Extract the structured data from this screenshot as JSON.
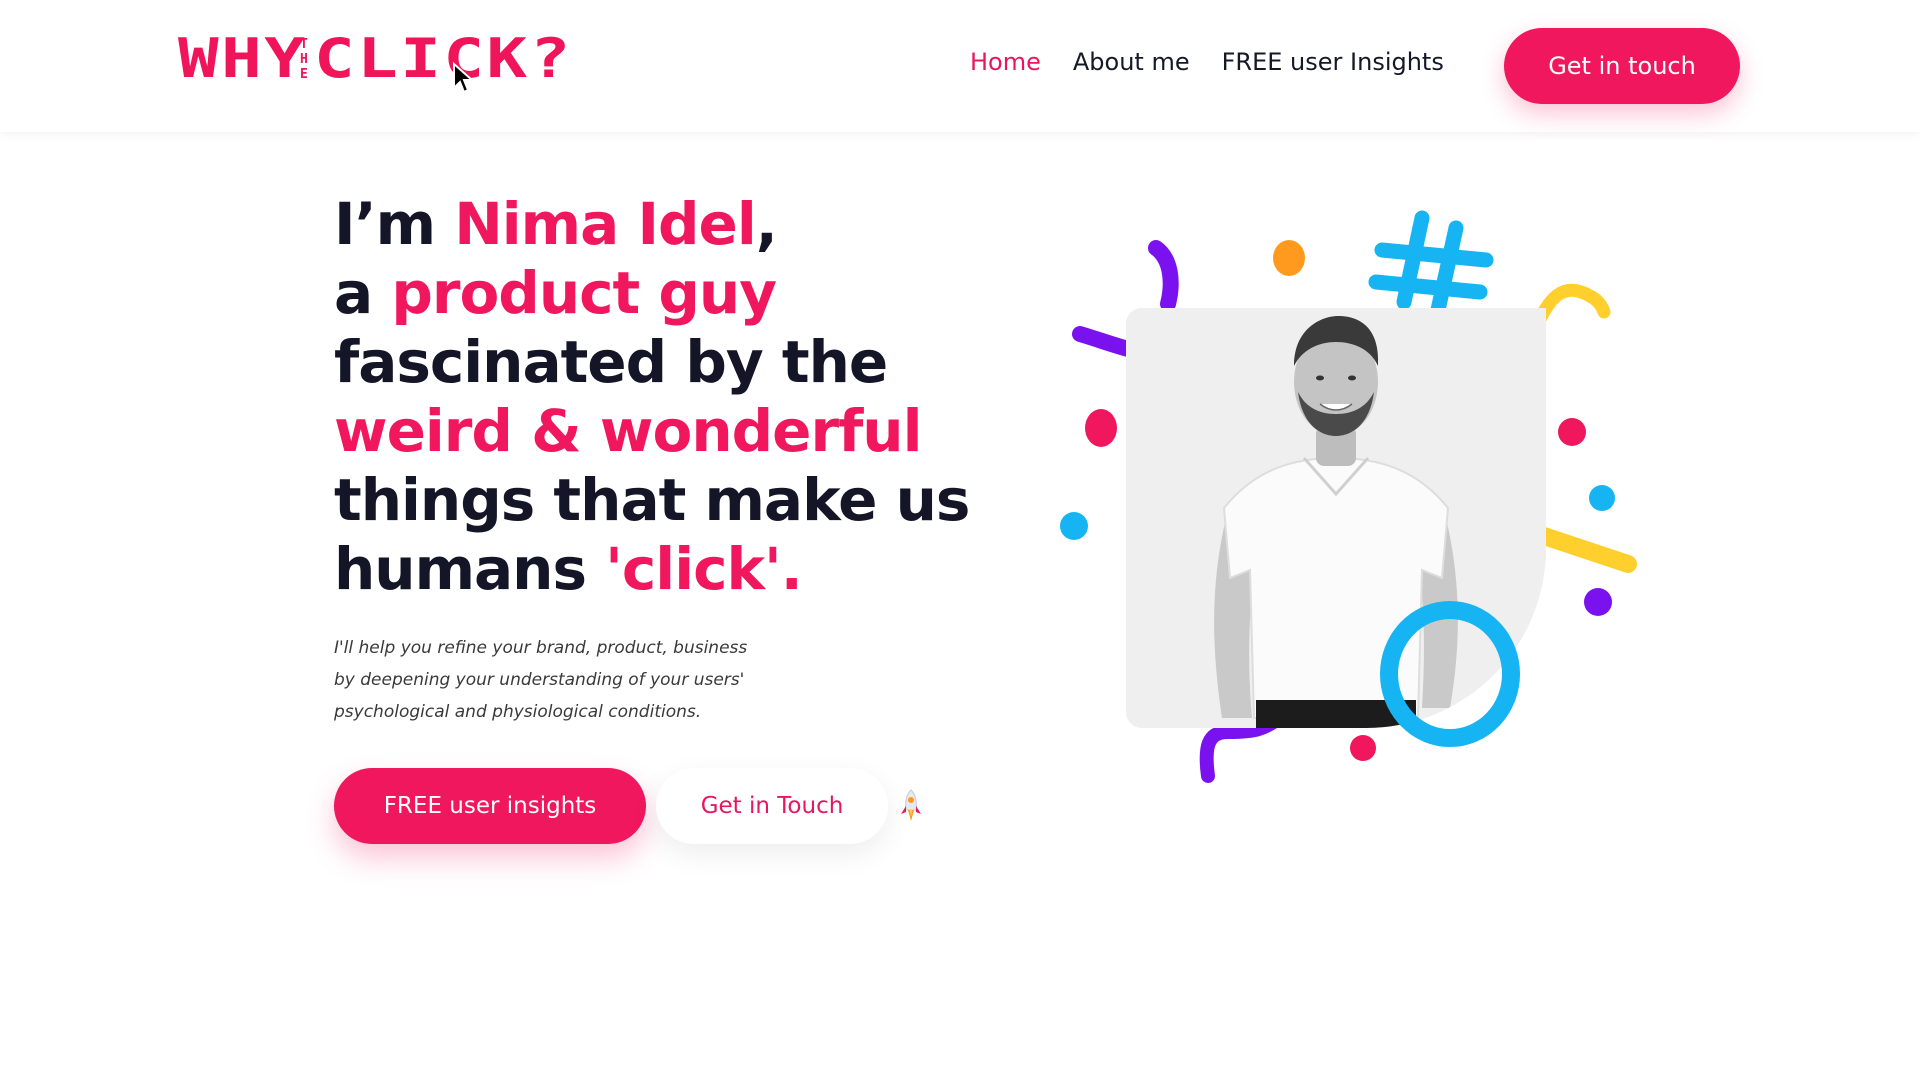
{
  "header": {
    "logo": {
      "word1": "WHY",
      "the_letters": [
        "T",
        "H",
        "E"
      ],
      "word2": "CLICK?"
    },
    "nav": [
      {
        "label": "Home",
        "active": true
      },
      {
        "label": "About me",
        "active": false
      },
      {
        "label": "FREE user Insights",
        "active": false
      }
    ],
    "cta_label": "Get in touch"
  },
  "hero": {
    "headline": {
      "line1_a": "I’m ",
      "line1_name": "Nima Idel",
      "line1_b": ",",
      "line2_a": "a ",
      "line2_b": "product guy",
      "line3": "fascinated by the",
      "line4": "weird & wonderful",
      "line5": "things that make us",
      "line6_a": "humans ",
      "line6_b": "'click'."
    },
    "subtext": {
      "line1": "I'll help you refine your brand, product, business",
      "line2": "by deepening your understanding of your users'",
      "line3": "psychological and physiological conditions."
    },
    "primary_button": "FREE user insights",
    "secondary_button": "Get in Touch",
    "decoration_icon": "rocket-icon"
  },
  "colors": {
    "brand_pink": "#f0175e",
    "dark_text": "#141526",
    "blue": "#16b4f2",
    "purple": "#7a12f0",
    "yellow": "#ffcf2e",
    "orange": "#ff9a1f"
  }
}
